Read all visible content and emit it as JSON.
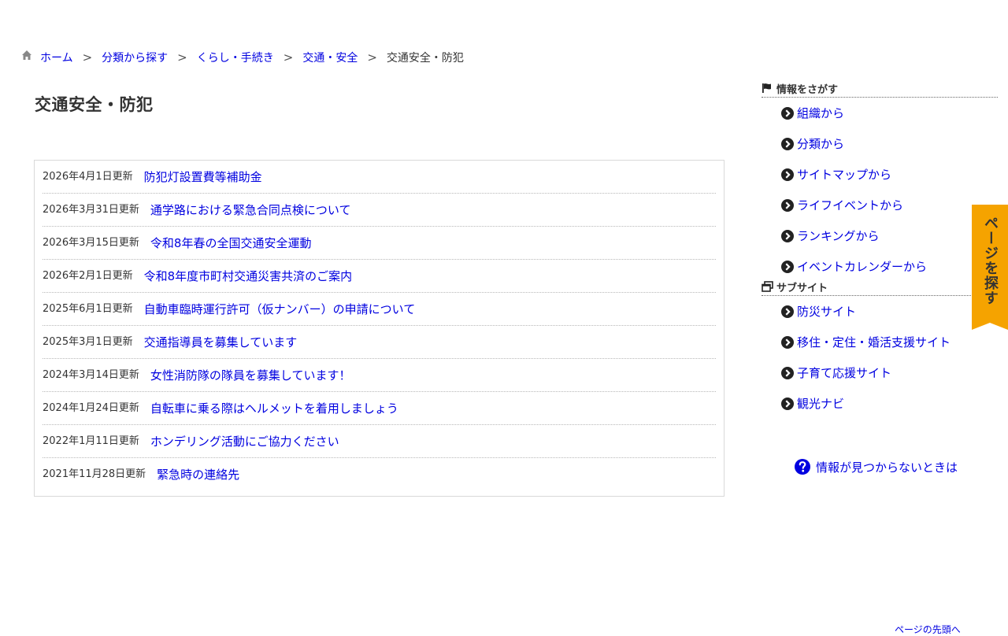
{
  "breadcrumb": {
    "items": [
      "ホーム",
      "分類から探す",
      "くらし・手続き",
      "交通・安全"
    ],
    "separator": ">",
    "current": "交通安全・防犯"
  },
  "page": {
    "title": "交通安全・防犯"
  },
  "news": [
    {
      "date": "2026年4月1日更新",
      "title": "防犯灯設置費等補助金"
    },
    {
      "date": "2026年3月31日更新",
      "title": "通学路における緊急合同点検について"
    },
    {
      "date": "2026年3月15日更新",
      "title": "令和8年春の全国交通安全運動"
    },
    {
      "date": "2026年2月1日更新",
      "title": "令和8年度市町村交通災害共済のご案内"
    },
    {
      "date": "2025年6月1日更新",
      "title": "自動車臨時運行許可（仮ナンバー）の申請について"
    },
    {
      "date": "2025年3月1日更新",
      "title": "交通指導員を募集しています"
    },
    {
      "date": "2024年3月14日更新",
      "title": "女性消防隊の隊員を募集しています！"
    },
    {
      "date": "2024年1月24日更新",
      "title": "自転車に乗る際はヘルメットを着用しましょう"
    },
    {
      "date": "2022年1月11日更新",
      "title": "ホンデリング活動にご協力ください"
    },
    {
      "date": "2021年11月28日更新",
      "title": "緊急時の連絡先"
    }
  ],
  "sidebar": {
    "search_heading": "情報をさがす",
    "search_items": [
      "組織から",
      "分類から",
      "サイトマップから",
      "ライフイベントから",
      "ランキングから",
      "イベントカレンダーから"
    ],
    "subsite_heading": "サブサイト",
    "subsite_items": [
      "防災サイト",
      "移住・定住・婚活支援サイト",
      "子育て応援サイト",
      "観光ナビ"
    ],
    "help_label": "情報が見つからないときは"
  },
  "side_tab": {
    "label": "ページを探す"
  },
  "bottom_partial": "ページの先頭へ",
  "colors": {
    "link": "#0000e0",
    "tab": "#f5a300",
    "text": "#333333"
  }
}
